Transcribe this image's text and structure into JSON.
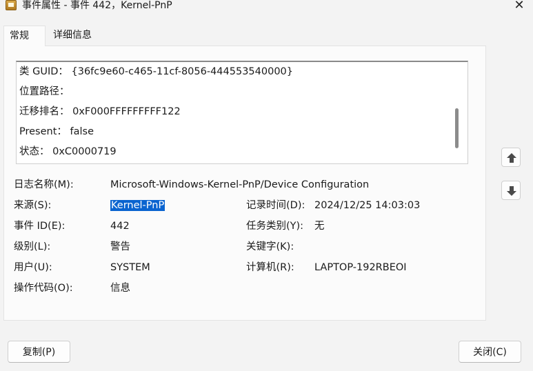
{
  "window": {
    "title": "事件属性 - 事件 442，Kernel-PnP",
    "close_glyph": "✕"
  },
  "tabs": [
    {
      "label": "常规",
      "active": true
    },
    {
      "label": "详细信息",
      "active": false
    }
  ],
  "description_lines": [
    "类 GUID： {36fc9e60-c465-11cf-8056-444553540000}",
    "位置路径：",
    "迁移排名： 0xF000FFFFFFFFF122",
    "Present： false",
    "状态： 0xC0000719"
  ],
  "fields": {
    "log_name_label": "日志名称(M):",
    "log_name_value": "Microsoft-Windows-Kernel-PnP/Device Configuration",
    "source_label": "来源(S):",
    "source_value": "Kernel-PnP",
    "logged_label": "记录时间(D):",
    "logged_value": "2024/12/25 14:03:03",
    "event_id_label": "事件 ID(E):",
    "event_id_value": "442",
    "task_label": "任务类别(Y):",
    "task_value": "无",
    "level_label": "级别(L):",
    "level_value": "警告",
    "keywords_label": "关键字(K):",
    "keywords_value": "",
    "user_label": "用户(U):",
    "user_value": "SYSTEM",
    "computer_label": "计算机(R):",
    "computer_value": "LAPTOP-192RBEOI",
    "opcode_label": "操作代码(O):",
    "opcode_value": "信息"
  },
  "buttons": {
    "copy": "复制(P)",
    "close": "关闭(C)"
  },
  "colors": {
    "selection": "#0a64d0",
    "window_bg": "#f3f3f3",
    "panel_bg": "#fbfbfb"
  }
}
